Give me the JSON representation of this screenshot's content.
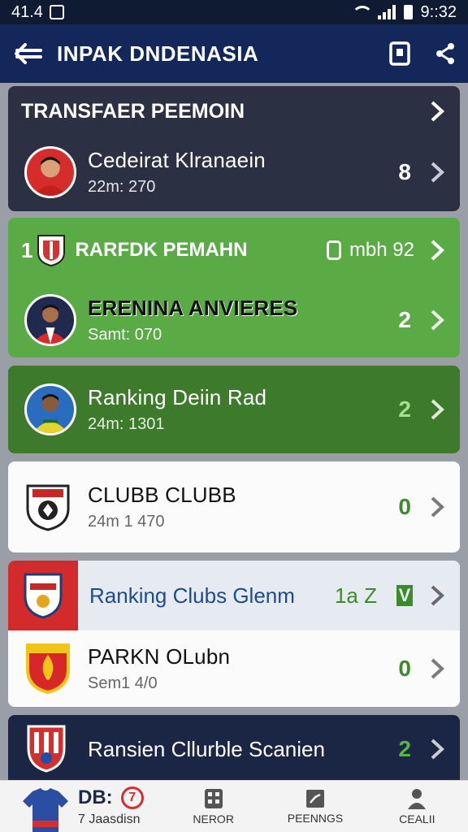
{
  "status": {
    "time_left": "41.4",
    "time_right": "9::32"
  },
  "header": {
    "title": "INPAK DNDENASIA"
  },
  "cards": {
    "transfer": {
      "title": "TRANSFAER PEEMOIN",
      "item": {
        "name": "Cedeirat Klranaein",
        "sub": "22m: 270",
        "count": "8"
      }
    },
    "ranking_green": {
      "rank": "1",
      "title": "RARFDK PEMAHN",
      "meta": "mbh 92",
      "item": {
        "name": "ERENINA ANVIERES",
        "sub": "Samt: 070",
        "count": "2"
      }
    },
    "ranking_dark": {
      "name": "Ranking Deiin Rad",
      "sub": "24m: 1301",
      "count": "2"
    },
    "club": {
      "name": "CLUBB CLUBB",
      "sub": "24m 1 470",
      "count": "0"
    },
    "ranking_club": {
      "title": "Ranking Clubs Glenm",
      "score": "1a Z",
      "flag": "V"
    },
    "parkn": {
      "name": "PARKN OLubn",
      "sub": "Sem1 4/0",
      "count": "0"
    },
    "bottom": {
      "name": "Ransien Cllurble Scanien",
      "count": "2"
    }
  },
  "bottom_nav": {
    "first_label": "DB:",
    "first_badge": "7",
    "first_sub": "7 Jaasdisn",
    "items": [
      {
        "label": "NEROR"
      },
      {
        "label": "PEENNGS"
      },
      {
        "label": "CEALII"
      }
    ]
  },
  "colors": {
    "header": "#13275a",
    "green": "#5aab45",
    "dark_green": "#3d7a2c",
    "count_green": "#3d8a2a",
    "card_dark": "#2b3142"
  }
}
